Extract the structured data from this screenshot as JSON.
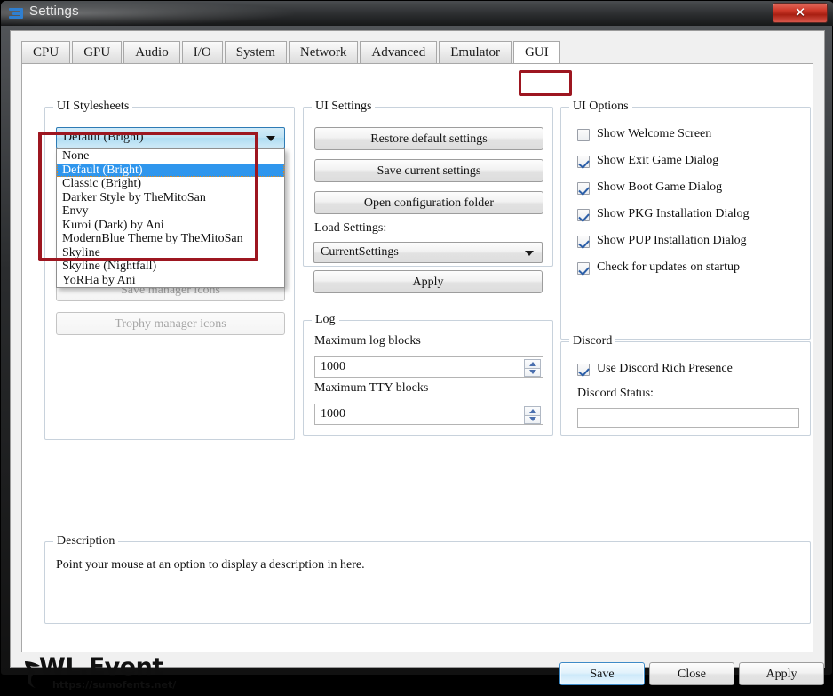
{
  "window": {
    "title": "Settings",
    "app_icon": "rpcs3-logo-icon",
    "close_label": "✕"
  },
  "tabs": [
    {
      "label": "CPU",
      "active": false
    },
    {
      "label": "GPU",
      "active": false
    },
    {
      "label": "Audio",
      "active": false
    },
    {
      "label": "I/O",
      "active": false
    },
    {
      "label": "System",
      "active": false
    },
    {
      "label": "Network",
      "active": false
    },
    {
      "label": "Advanced",
      "active": false
    },
    {
      "label": "Emulator",
      "active": false
    },
    {
      "label": "GUI",
      "active": true
    }
  ],
  "stylesheets": {
    "legend": "UI Stylesheets",
    "selected": "Default (Bright)",
    "options": [
      "None",
      "Default (Bright)",
      "Classic (Bright)",
      "Darker Style by TheMitoSan",
      "Envy",
      "Kuroi (Dark) by Ani",
      "ModernBlue Theme by TheMitoSan",
      "Skyline",
      "Skyline (Nightfall)",
      "YoRHa by Ani"
    ],
    "highlighted_option": "Default (Bright)",
    "buttons": [
      {
        "label": "Save manager icons",
        "disabled": true
      },
      {
        "label": "Trophy manager icons",
        "disabled": true
      }
    ]
  },
  "ui_settings": {
    "legend": "UI Settings",
    "restore_defaults": "Restore default settings",
    "save_current": "Save current settings",
    "open_config_folder": "Open configuration folder",
    "load_settings_label": "Load Settings:",
    "load_settings_value": "CurrentSettings",
    "apply": "Apply"
  },
  "log": {
    "legend": "Log",
    "max_log_blocks_label": "Maximum log blocks",
    "max_log_blocks_value": "1000",
    "max_tty_blocks_label": "Maximum TTY blocks",
    "max_tty_blocks_value": "1000"
  },
  "ui_options": {
    "legend": "UI Options",
    "items": [
      {
        "label": "Show Welcome Screen",
        "checked": false
      },
      {
        "label": "Show Exit Game Dialog",
        "checked": true
      },
      {
        "label": "Show Boot Game Dialog",
        "checked": true
      },
      {
        "label": "Show PKG Installation Dialog",
        "checked": true
      },
      {
        "label": "Show PUP Installation Dialog",
        "checked": true
      },
      {
        "label": "Check for updates on startup",
        "checked": true
      }
    ]
  },
  "discord": {
    "legend": "Discord",
    "rich_presence_label": "Use Discord Rich Presence",
    "rich_presence_checked": true,
    "status_label": "Discord Status:",
    "status_value": ""
  },
  "description": {
    "legend": "Description",
    "text": "Point your mouse at an option to display a description in here."
  },
  "footer": {
    "logo_text": "WL.Event",
    "logo_url": "https://sumofents.net/",
    "save": "Save",
    "close": "Close",
    "apply": "Apply"
  },
  "colors": {
    "annotation_red": "#9d1620",
    "selection_blue": "#2f96ed",
    "accent_blue": "#2c5fa8",
    "close_red": "#cf3a2b"
  }
}
